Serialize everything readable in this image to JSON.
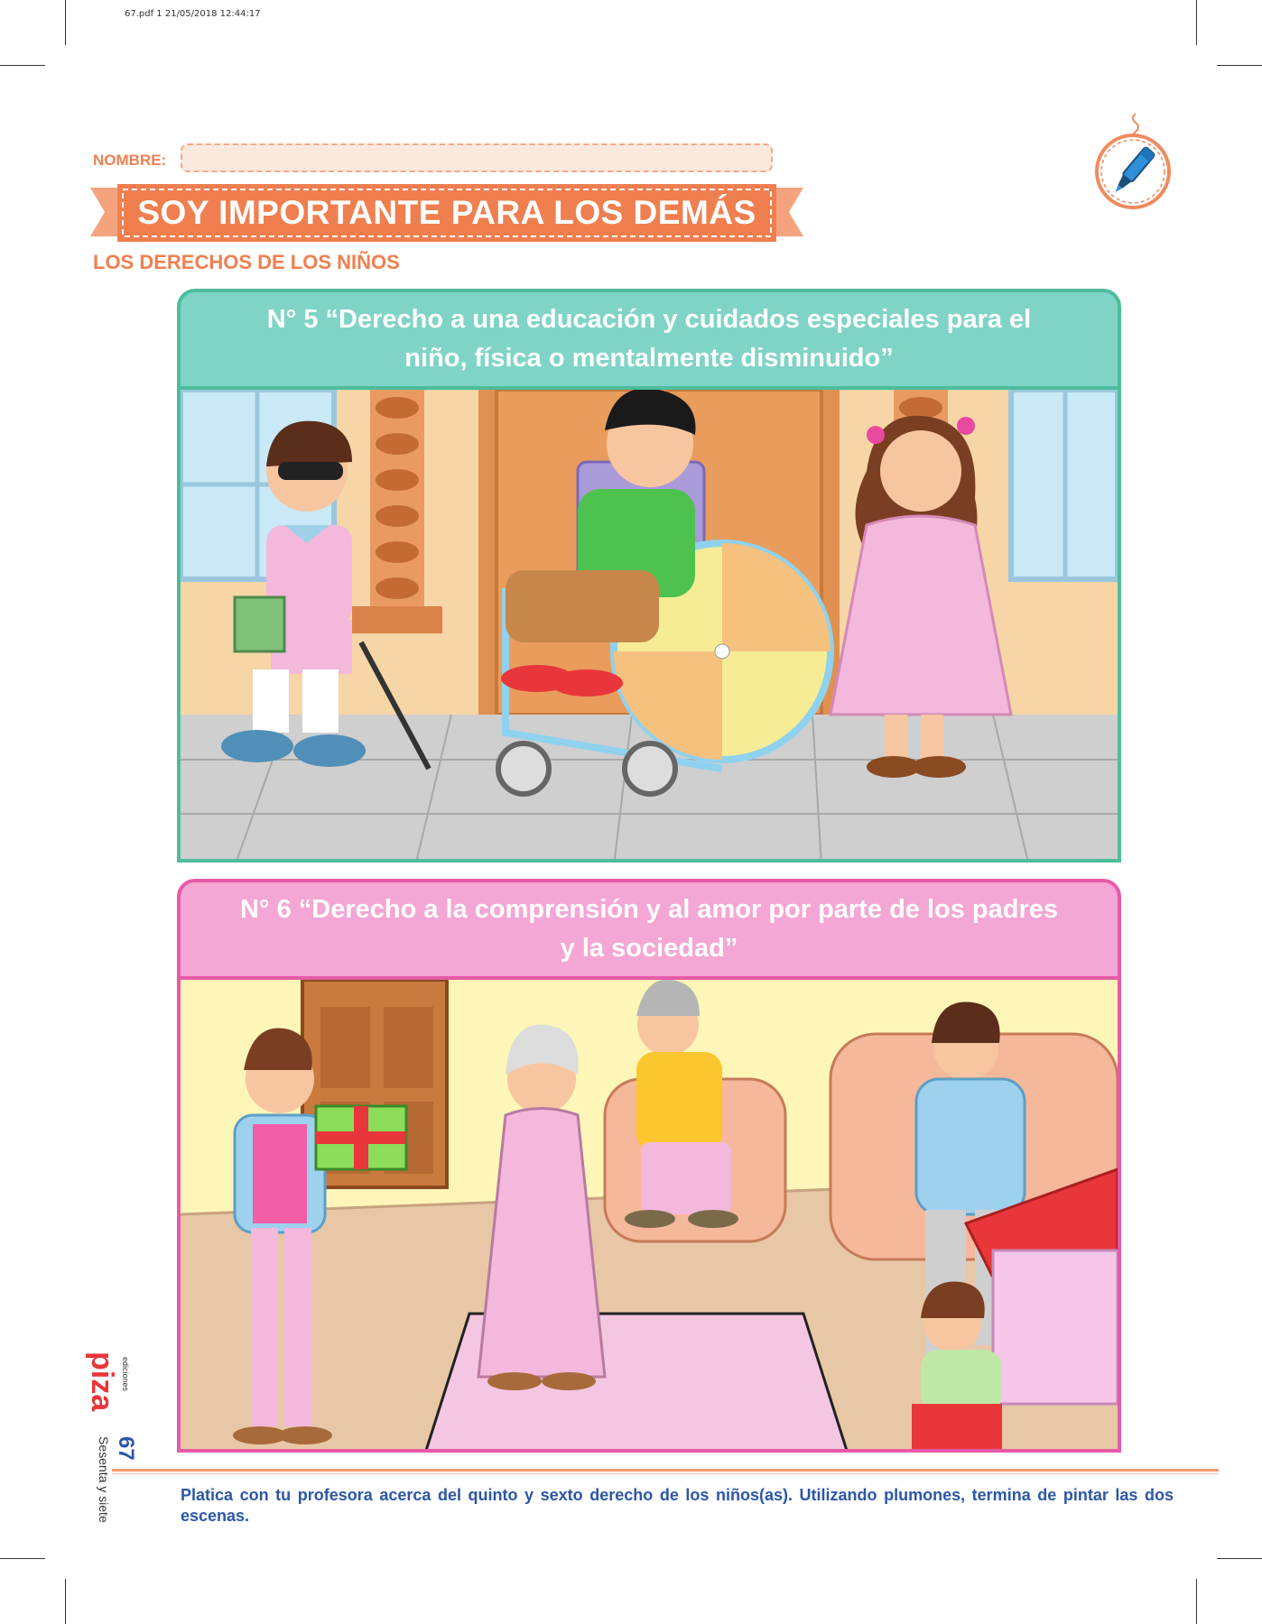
{
  "print_header": "67.pdf   1   21/05/2018   12:44:17",
  "name_label": "NOMBRE:",
  "title": "SOY IMPORTANTE PARA LOS DEMÁS",
  "subtitle": "LOS DERECHOS DE LOS NIÑOS",
  "panels": [
    {
      "heading_line1": "N° 5 “Derecho a una educación y cuidados especiales para el",
      "heading_line2": "niño, física o mentalmente disminuido”"
    },
    {
      "heading_line1": "N° 6 “Derecho a la comprensión y al amor por parte de los padres",
      "heading_line2": "y la sociedad”"
    }
  ],
  "instructions": "Platica con tu profesora acerca del quinto y sexto derecho de los niños(as). Utilizando plumones, termina de pintar las dos escenas.",
  "publisher": "piza",
  "publisher_small": "ediciones",
  "page_number": "67",
  "page_words": "Sesenta y siete",
  "colors": {
    "accent_orange": "#f07f50",
    "panel1_green": "#7fd4c6",
    "panel2_pink": "#f4a6d4",
    "instruction_blue": "#2c56a8"
  },
  "icons": [
    "marker-icon"
  ]
}
